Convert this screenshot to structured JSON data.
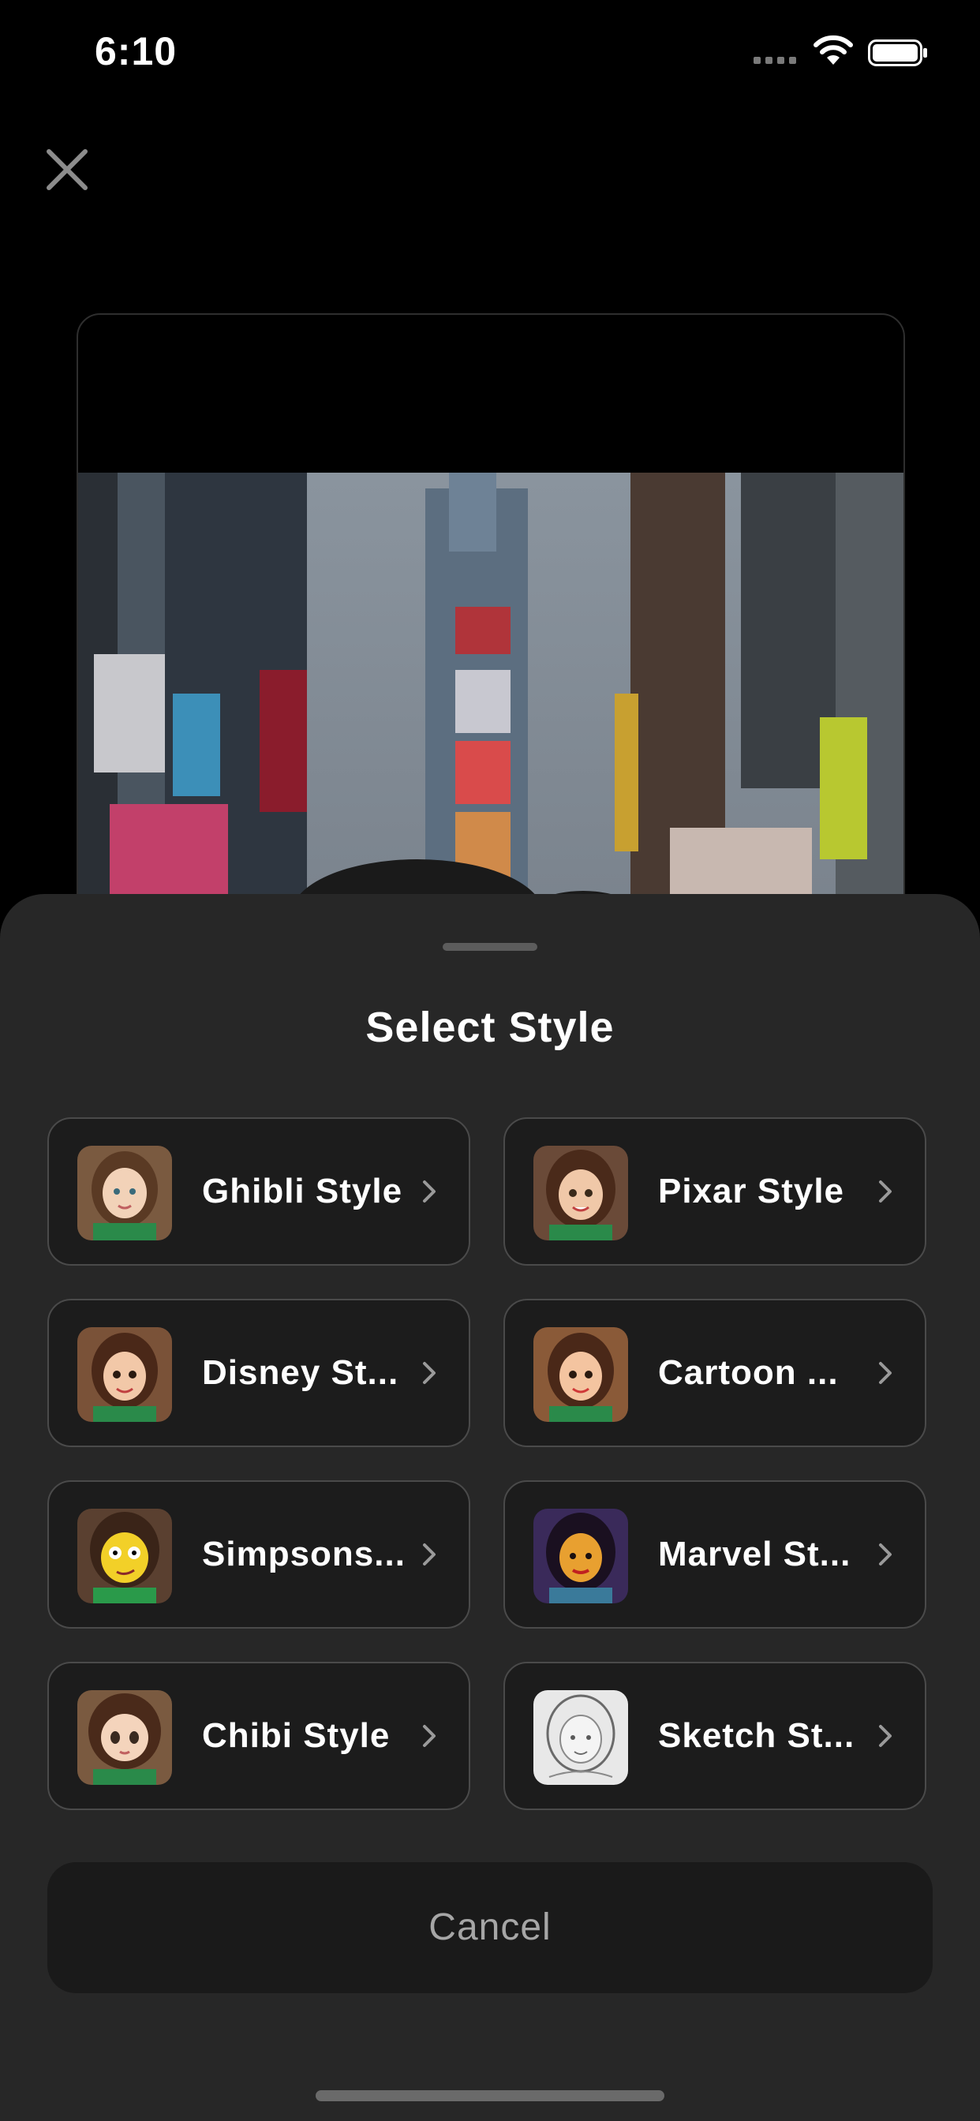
{
  "status_bar": {
    "time": "6:10"
  },
  "sheet": {
    "title": "Select Style",
    "styles": [
      {
        "label": "Ghibli Style",
        "icon": "ghibli-avatar"
      },
      {
        "label": "Pixar Style",
        "icon": "pixar-avatar"
      },
      {
        "label": "Disney St...",
        "icon": "disney-avatar"
      },
      {
        "label": "Cartoon ...",
        "icon": "cartoon-avatar"
      },
      {
        "label": "Simpsons...",
        "icon": "simpsons-avatar"
      },
      {
        "label": "Marvel St...",
        "icon": "marvel-avatar"
      },
      {
        "label": "Chibi Style",
        "icon": "chibi-avatar"
      },
      {
        "label": "Sketch St...",
        "icon": "sketch-avatar"
      }
    ],
    "cancel_label": "Cancel"
  },
  "colors": {
    "background": "#000000",
    "sheet": "#272727",
    "card": "#1c1c1c",
    "card_border": "#4a4a4a",
    "cancel_text": "#a6a6a6"
  }
}
